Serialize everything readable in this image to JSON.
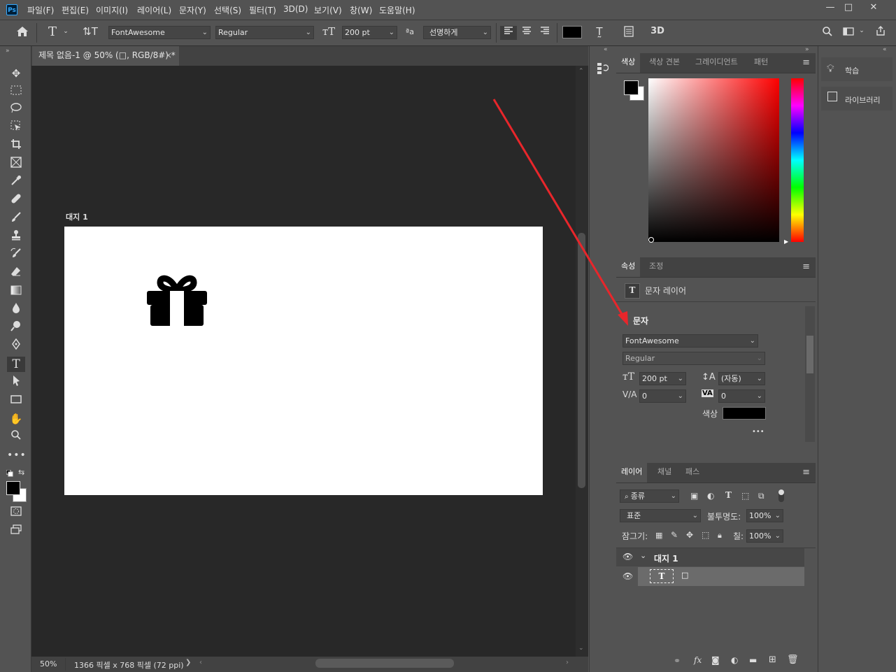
{
  "menu": [
    "파일(F)",
    "편집(E)",
    "이미지(I)",
    "레이어(L)",
    "문자(Y)",
    "선택(S)",
    "필터(T)",
    "3D(D)",
    "보기(V)",
    "창(W)",
    "도움말(H)"
  ],
  "app_logo": "Ps",
  "window_controls": {
    "minimize": "—",
    "maximize": "□",
    "close": "✕"
  },
  "options": {
    "font_family": "FontAwesome",
    "font_style": "Regular",
    "font_size": "200 pt",
    "aa_icon_text": "ªa",
    "antialias": "선명하게",
    "three_d": "3D"
  },
  "document": {
    "tab_title": "제목 없음-1 @ 50% (□, RGB/8#) *",
    "tab_close": "×",
    "artboard_label": "대지 1",
    "zoom": "50%",
    "info": "1366 픽셀 x 768 픽셀 (72 ppi)",
    "info_arrow": "❯",
    "gift_icon": "gift-icon"
  },
  "color_panel": {
    "tabs": [
      "색상",
      "색상 견본",
      "그레이디언트",
      "패턴"
    ],
    "foreground": "#000000",
    "background": "#ffffff",
    "hue_color": "#ff0000"
  },
  "properties": {
    "tabs": [
      "속성",
      "조정"
    ],
    "layer_type": "문자 레이어",
    "section": "문자",
    "font_family": "FontAwesome",
    "font_style": "Regular",
    "size": "200 pt",
    "leading": "(자동)",
    "kerning": "0",
    "tracking": "0",
    "color_label": "색상",
    "text_color": "#000000",
    "more": "•••"
  },
  "layers": {
    "tabs": [
      "레이어",
      "채널",
      "패스"
    ],
    "filter": "종류",
    "blend_mode": "표준",
    "opacity_label": "불투명도:",
    "opacity": "100%",
    "lock_label": "잠그기:",
    "fill_label": "칠:",
    "fill": "100%",
    "artboard_name": "대지 1",
    "text_layer_name": "□",
    "footer_fx": "fx"
  },
  "learn_panel": {
    "learn": "학습",
    "libraries": "라이브러리"
  },
  "annotation": {
    "arrow_color": "#e8262b"
  }
}
